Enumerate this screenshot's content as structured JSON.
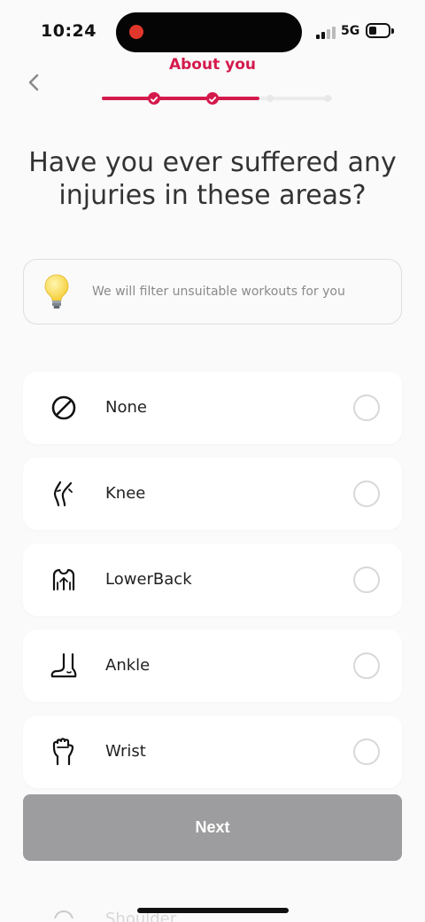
{
  "status_bar": {
    "time": "10:24",
    "network": "5G"
  },
  "header": {
    "title": "About you"
  },
  "progress": {
    "completed_steps": 2,
    "total_steps": 4
  },
  "question": "Have you ever suffered any injuries in these areas?",
  "hint": {
    "text": "We will filter unsuitable workouts for you",
    "icon": "lightbulb-icon"
  },
  "options": [
    {
      "label": "None",
      "icon": "none-icon",
      "selected": false
    },
    {
      "label": "Knee",
      "icon": "knee-icon",
      "selected": false
    },
    {
      "label": "LowerBack",
      "icon": "lower-back-icon",
      "selected": false
    },
    {
      "label": "Ankle",
      "icon": "ankle-icon",
      "selected": false
    },
    {
      "label": "Wrist",
      "icon": "wrist-icon",
      "selected": false
    }
  ],
  "partially_hidden_option": {
    "label": "Shoulder",
    "icon": "shoulder-icon"
  },
  "next_button": {
    "label": "Next",
    "enabled": false
  },
  "colors": {
    "accent": "#d41a4c",
    "button_disabled": "#9d9d9f",
    "background": "#fafafa"
  }
}
